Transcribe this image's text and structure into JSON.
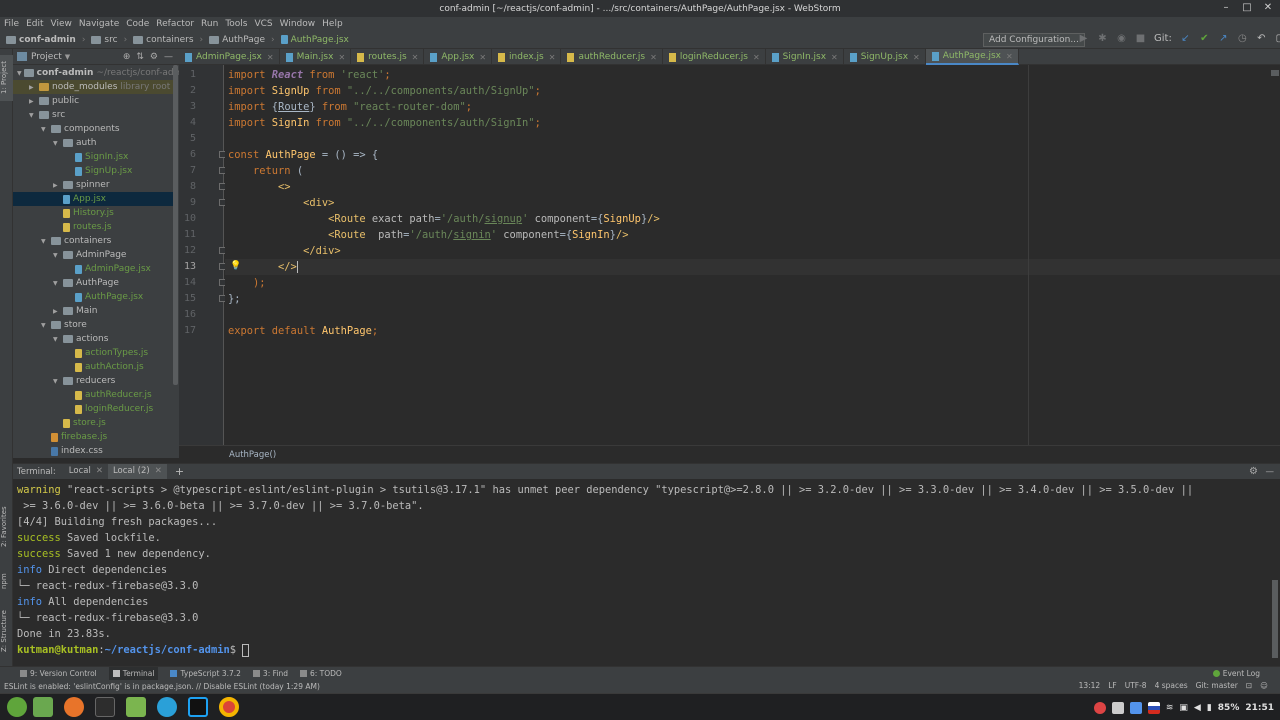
{
  "window": {
    "title": "conf-admin [~/reactjs/conf-admin] - .../src/containers/AuthPage/AuthPage.jsx - WebStorm"
  },
  "menu": [
    "File",
    "Edit",
    "View",
    "Navigate",
    "Code",
    "Refactor",
    "Run",
    "Tools",
    "VCS",
    "Window",
    "Help"
  ],
  "breadcrumbs": [
    "conf-admin",
    "src",
    "containers",
    "AuthPage",
    "AuthPage.jsx"
  ],
  "toolbar": {
    "add_configuration": "Add Configuration...",
    "git_label": "Git:"
  },
  "project": {
    "title": "Project",
    "tree": [
      {
        "label": "conf-admin",
        "sub": "~/reactjs/conf-admin",
        "depth": 0,
        "open": true,
        "kind": "folder",
        "bold": true
      },
      {
        "label": "node_modules",
        "sub": "library root",
        "depth": 1,
        "open": false,
        "kind": "folder-orange",
        "hl": true
      },
      {
        "label": "public",
        "depth": 1,
        "open": false,
        "kind": "folder"
      },
      {
        "label": "src",
        "depth": 1,
        "open": true,
        "kind": "folder"
      },
      {
        "label": "components",
        "depth": 2,
        "open": true,
        "kind": "folder"
      },
      {
        "label": "auth",
        "depth": 3,
        "open": true,
        "kind": "folder"
      },
      {
        "label": "SignIn.jsx",
        "depth": 4,
        "kind": "jsx"
      },
      {
        "label": "SignUp.jsx",
        "depth": 4,
        "kind": "jsx"
      },
      {
        "label": "spinner",
        "depth": 3,
        "open": false,
        "kind": "folder"
      },
      {
        "label": "App.jsx",
        "depth": 3,
        "kind": "jsx",
        "sel": true
      },
      {
        "label": "History.js",
        "depth": 3,
        "kind": "js"
      },
      {
        "label": "routes.js",
        "depth": 3,
        "kind": "js"
      },
      {
        "label": "containers",
        "depth": 2,
        "open": true,
        "kind": "folder"
      },
      {
        "label": "AdminPage",
        "depth": 3,
        "open": true,
        "kind": "folder"
      },
      {
        "label": "AdminPage.jsx",
        "depth": 4,
        "kind": "jsx"
      },
      {
        "label": "AuthPage",
        "depth": 3,
        "open": true,
        "kind": "folder"
      },
      {
        "label": "AuthPage.jsx",
        "depth": 4,
        "kind": "jsx"
      },
      {
        "label": "Main",
        "depth": 3,
        "open": false,
        "kind": "folder"
      },
      {
        "label": "store",
        "depth": 2,
        "open": true,
        "kind": "folder"
      },
      {
        "label": "actions",
        "depth": 3,
        "open": true,
        "kind": "folder"
      },
      {
        "label": "actionTypes.js",
        "depth": 4,
        "kind": "js"
      },
      {
        "label": "authAction.js",
        "depth": 4,
        "kind": "js"
      },
      {
        "label": "reducers",
        "depth": 3,
        "open": true,
        "kind": "folder"
      },
      {
        "label": "authReducer.js",
        "depth": 4,
        "kind": "js"
      },
      {
        "label": "loginReducer.js",
        "depth": 4,
        "kind": "js"
      },
      {
        "label": "store.js",
        "depth": 3,
        "kind": "js"
      },
      {
        "label": "firebase.js",
        "depth": 2,
        "kind": "fire"
      },
      {
        "label": "index.css",
        "depth": 2,
        "kind": "css",
        "plain": true
      }
    ]
  },
  "left_strip": [
    "1: Project",
    "2: Favorites",
    "npm",
    "Z: Structure"
  ],
  "tabs": [
    {
      "label": "AdminPage.jsx",
      "kind": "jsx"
    },
    {
      "label": "Main.jsx",
      "kind": "jsx"
    },
    {
      "label": "routes.js",
      "kind": "js"
    },
    {
      "label": "App.jsx",
      "kind": "jsx"
    },
    {
      "label": "index.js",
      "kind": "js"
    },
    {
      "label": "authReducer.js",
      "kind": "js"
    },
    {
      "label": "loginReducer.js",
      "kind": "js"
    },
    {
      "label": "SignIn.jsx",
      "kind": "jsx"
    },
    {
      "label": "SignUp.jsx",
      "kind": "jsx"
    },
    {
      "label": "AuthPage.jsx",
      "kind": "jsx",
      "active": true
    }
  ],
  "editor": {
    "line_numbers": [
      "1",
      "2",
      "3",
      "4",
      "5",
      "6",
      "7",
      "8",
      "9",
      "10",
      "11",
      "12",
      "13",
      "14",
      "15",
      "16",
      "17"
    ],
    "current_line": 13,
    "lines": [
      [
        [
          "kw",
          "import "
        ],
        [
          "ital",
          "React"
        ],
        [
          "kw",
          " from "
        ],
        [
          "str",
          "'react'"
        ],
        [
          "kw",
          ";"
        ]
      ],
      [
        [
          "kw",
          "import "
        ],
        [
          "cls",
          "SignUp"
        ],
        [
          "kw",
          " from "
        ],
        [
          "str",
          "\"../../components/auth/SignUp\""
        ],
        [
          "kw",
          ";"
        ]
      ],
      [
        [
          "kw",
          "import "
        ],
        [
          "jsxv",
          "{"
        ],
        [
          "jsxvul",
          "Route"
        ],
        [
          "jsxv",
          "} "
        ],
        [
          "kw",
          "from "
        ],
        [
          "str",
          "\"react-router-dom\""
        ],
        [
          "kw",
          ";"
        ]
      ],
      [
        [
          "kw",
          "import "
        ],
        [
          "cls",
          "SignIn"
        ],
        [
          "kw",
          " from "
        ],
        [
          "str",
          "\"../../components/auth/SignIn\""
        ],
        [
          "kw",
          ";"
        ]
      ],
      [],
      [
        [
          "kw",
          "const "
        ],
        [
          "cls",
          "AuthPage"
        ],
        [
          "jsxv",
          " = () => {"
        ]
      ],
      [
        [
          "jsxv",
          "    "
        ],
        [
          "kw",
          "return "
        ],
        [
          "jsxv",
          "("
        ]
      ],
      [
        [
          "jsxv",
          "        "
        ],
        [
          "tag",
          "<>"
        ]
      ],
      [
        [
          "jsxv",
          "            "
        ],
        [
          "tag",
          "<div>"
        ]
      ],
      [
        [
          "jsxv",
          "                "
        ],
        [
          "tag",
          "<Route "
        ],
        [
          "attr",
          "exact path"
        ],
        [
          "jsxv",
          "="
        ],
        [
          "str",
          "'/auth/"
        ],
        [
          "strul",
          "signup"
        ],
        [
          "str",
          "'"
        ],
        [
          "attr",
          " component"
        ],
        [
          "jsxv",
          "={"
        ],
        [
          "cls",
          "SignUp"
        ],
        [
          "jsxv",
          "}"
        ],
        [
          "tag",
          "/>"
        ]
      ],
      [
        [
          "jsxv",
          "                "
        ],
        [
          "tag",
          "<Route  "
        ],
        [
          "attr",
          "path"
        ],
        [
          "jsxv",
          "="
        ],
        [
          "str",
          "'/auth/"
        ],
        [
          "strul",
          "signin"
        ],
        [
          "str",
          "'"
        ],
        [
          "attr",
          " component"
        ],
        [
          "jsxv",
          "={"
        ],
        [
          "cls",
          "SignIn"
        ],
        [
          "jsxv",
          "}"
        ],
        [
          "tag",
          "/>"
        ]
      ],
      [
        [
          "jsxv",
          "            "
        ],
        [
          "tag",
          "</div>"
        ]
      ],
      [
        [
          "jsxv",
          "        "
        ],
        [
          "tag",
          "</>"
        ]
      ],
      [
        [
          "jsxv",
          "    "
        ],
        [
          "kw",
          ");"
        ]
      ],
      [
        [
          "jsxv",
          "};"
        ]
      ],
      [],
      [
        [
          "kw",
          "export default "
        ],
        [
          "cls",
          "AuthPage"
        ],
        [
          "kw",
          ";"
        ]
      ]
    ],
    "breadcrumb": "AuthPage()"
  },
  "terminal": {
    "title": "Terminal:",
    "tabs": [
      "Local",
      "Local (2)"
    ],
    "lines": [
      [
        [
          "ty",
          "warning"
        ],
        [
          "t",
          " \"react-scripts > @typescript-eslint/eslint-plugin > tsutils@3.17.1\" has unmet peer dependency \"typescript@>=2.8.0 || >= 3.2.0-dev || >= 3.3.0-dev || >= 3.4.0-dev || >= 3.5.0-dev ||"
        ]
      ],
      [
        [
          "t",
          " >= 3.6.0-dev || >= 3.6.0-beta || >= 3.7.0-dev || >= 3.7.0-beta\"."
        ]
      ],
      [
        [
          "t",
          "[4/4] Building fresh packages..."
        ]
      ],
      [
        [
          "tg",
          "success"
        ],
        [
          "t",
          " Saved lockfile."
        ]
      ],
      [
        [
          "tg",
          "success"
        ],
        [
          "t",
          " Saved 1 new dependency."
        ]
      ],
      [
        [
          "tb",
          "info"
        ],
        [
          "t",
          " Direct dependencies"
        ]
      ],
      [
        [
          "t",
          "└─ react-redux-firebase@3.3.0"
        ]
      ],
      [
        [
          "tb",
          "info"
        ],
        [
          "t",
          " All dependencies"
        ]
      ],
      [
        [
          "t",
          "└─ react-redux-firebase@3.3.0"
        ]
      ],
      [
        [
          "t",
          "Done in 23.83s."
        ]
      ]
    ],
    "prompt_user": "kutman@kutman",
    "prompt_path": "~/reactjs/conf-admin",
    "prompt_sym": "$ "
  },
  "toolwindows": [
    "9: Version Control",
    "Terminal",
    "TypeScript 3.7.2",
    "3: Find",
    "6: TODO"
  ],
  "event_log": "Event Log",
  "status": {
    "message": "ESLint is enabled: 'eslintConfig' is in package.json. // Disable ESLint (today 1:29 AM)",
    "position": "13:12",
    "line_sep": "LF",
    "encoding": "UTF-8",
    "indent": "4 spaces",
    "git": "Git: master"
  },
  "taskbar": {
    "battery": "85%",
    "clock": "21:51"
  }
}
